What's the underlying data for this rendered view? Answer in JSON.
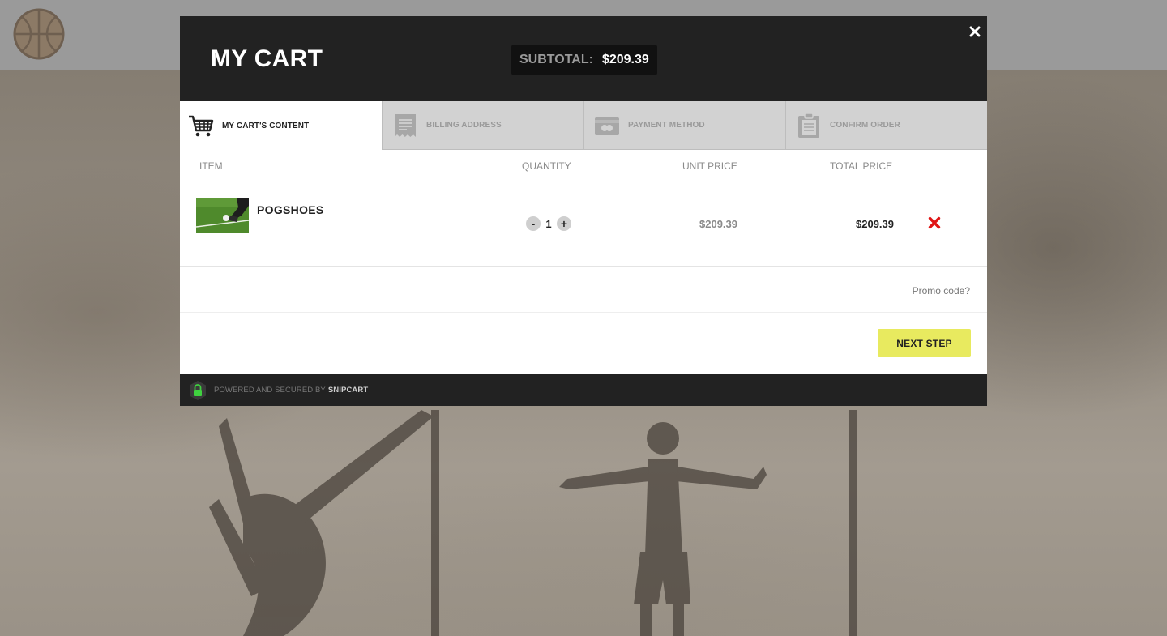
{
  "background": {
    "logo_icon": "basketball-icon"
  },
  "cart": {
    "title": "MY CART",
    "subtotal_label": "SUBTOTAL:",
    "subtotal_value": "$209.39",
    "close_icon": "close-icon"
  },
  "tabs": [
    {
      "label": "MY CART'S CONTENT",
      "icon": "shopping-cart-icon",
      "active": true
    },
    {
      "label": "BILLING ADDRESS",
      "icon": "receipt-icon",
      "active": false
    },
    {
      "label": "PAYMENT METHOD",
      "icon": "credit-card-icon",
      "active": false
    },
    {
      "label": "CONFIRM ORDER",
      "icon": "clipboard-icon",
      "active": false
    }
  ],
  "table": {
    "headers": {
      "item": "ITEM",
      "quantity": "QUANTITY",
      "unit_price": "UNIT PRICE",
      "total_price": "TOTAL PRICE"
    },
    "rows": [
      {
        "name": "POGSHOES",
        "quantity": "1",
        "decrement": "-",
        "increment": "+",
        "unit_price": "$209.39",
        "total_price": "$209.39",
        "remove_icon": "remove-x-icon"
      }
    ]
  },
  "promo": {
    "label": "Promo code?"
  },
  "actions": {
    "next_step": "NEXT STEP"
  },
  "footer": {
    "powered_text": "POWERED AND SECURED BY",
    "brand": "SNIPCART",
    "lock_icon": "lock-icon"
  },
  "colors": {
    "header_bg": "#222222",
    "accent_button": "#e8ea5f",
    "remove_red": "#e01515",
    "lock_green": "#3fd13f"
  }
}
